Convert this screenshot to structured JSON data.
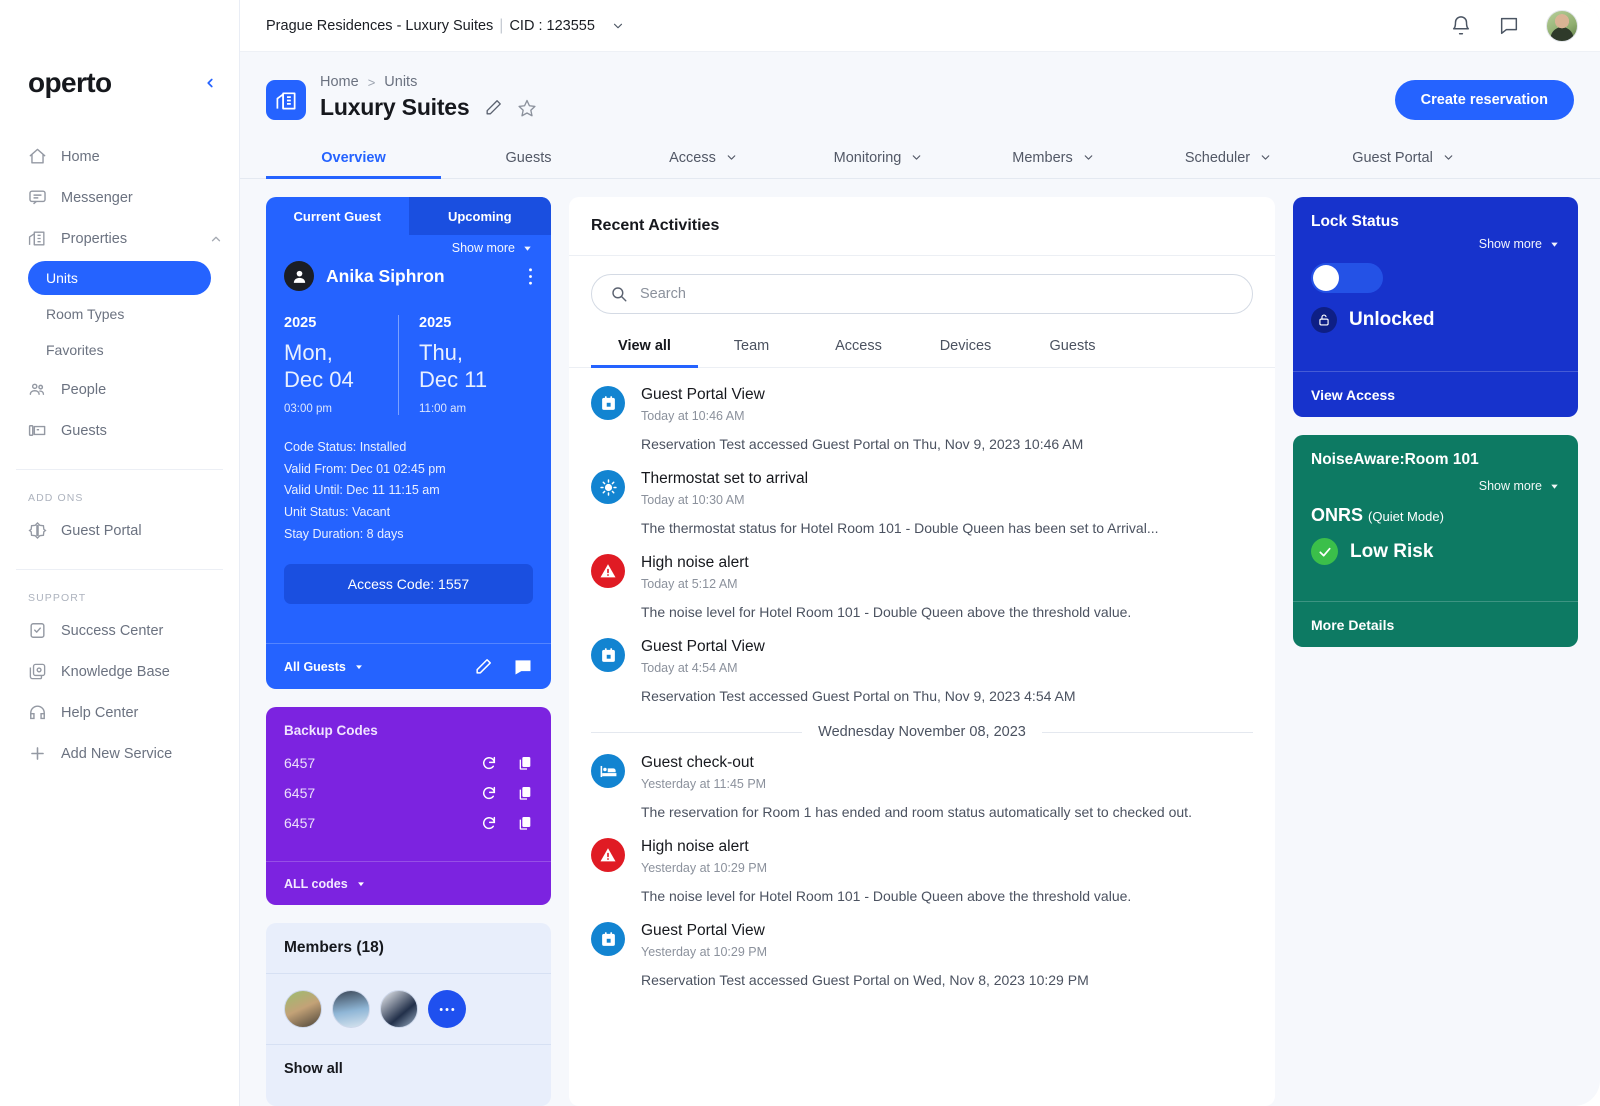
{
  "sidebar": {
    "brand": "operto",
    "collapse_icon": "chevron-left-icon",
    "nav": [
      {
        "label": "Home",
        "icon": "home-icon"
      },
      {
        "label": "Messenger",
        "icon": "messenger-icon"
      },
      {
        "label": "Properties",
        "icon": "properties-icon",
        "caret": "chevron-up-icon"
      }
    ],
    "properties_sub": [
      {
        "label": "Units",
        "active": true
      },
      {
        "label": "Room Types",
        "active": false
      },
      {
        "label": "Favorites",
        "active": false
      }
    ],
    "nav2": [
      {
        "label": "People",
        "icon": "people-icon"
      },
      {
        "label": "Guests",
        "icon": "guests-icon"
      }
    ],
    "addons_title": "ADD ONS",
    "addons": [
      {
        "label": "Guest Portal",
        "icon": "guest-portal-icon"
      }
    ],
    "support_title": "SUPPORT",
    "support": [
      {
        "label": "Success Center",
        "icon": "clipboard-check-icon"
      },
      {
        "label": "Knowledge Base",
        "icon": "book-icon"
      },
      {
        "label": "Help Center",
        "icon": "help-icon"
      },
      {
        "label": "Add New Service",
        "icon": "plus-icon"
      }
    ]
  },
  "topbar": {
    "property": "Prague Residences - Luxury Suites",
    "cid": "CID : 123555",
    "caret": "chevron-down-icon",
    "bell": "bell-icon",
    "chat": "chat-icon",
    "avatar": "user-avatar"
  },
  "page": {
    "breadcrumb": [
      "Home",
      "Units"
    ],
    "separator": ">",
    "title": "Luxury Suites",
    "edit_icon": "pencil-icon",
    "star_icon": "star-icon",
    "create_button": "Create reservation"
  },
  "tabs": [
    {
      "label": "Overview",
      "caret": false,
      "active": true
    },
    {
      "label": "Guests",
      "caret": false,
      "active": false
    },
    {
      "label": "Access",
      "caret": true,
      "active": false
    },
    {
      "label": "Monitoring",
      "caret": true,
      "active": false
    },
    {
      "label": "Members",
      "caret": true,
      "active": false
    },
    {
      "label": "Scheduler",
      "caret": true,
      "active": false
    },
    {
      "label": "Guest Portal",
      "caret": true,
      "active": false
    }
  ],
  "guest_card": {
    "tab_current": "Current Guest",
    "tab_upcoming": "Upcoming",
    "show_more": "Show more",
    "guest_name": "Anika Siphron",
    "checkin": {
      "year": "2025",
      "day": "Mon,",
      "date": "Dec 04",
      "time": "03:00 pm"
    },
    "checkout": {
      "year": "2025",
      "day": "Thu,",
      "date": "Dec 11",
      "time": "11:00 am"
    },
    "meta": [
      "Code Status: Installed",
      "Valid From: Dec 01 02:45 pm",
      "Valid Until: Dec 11 11:15 am",
      "Unit Status: Vacant",
      "Stay Duration: 8 days"
    ],
    "access_code": "Access Code: 1557",
    "all_guests": "All Guests",
    "edit_icon": "pencil-icon",
    "message_icon": "message-icon"
  },
  "backup_codes": {
    "title": "Backup Codes",
    "codes": [
      "6457",
      "6457",
      "6457"
    ],
    "refresh_icon": "refresh-icon",
    "copy_icon": "copy-icon",
    "footer": "ALL codes"
  },
  "members": {
    "title": "Members (18)",
    "more_label": "•••",
    "show_all": "Show all"
  },
  "activities": {
    "title": "Recent Activities",
    "search_placeholder": "Search",
    "search_value": "",
    "search_icon": "search-icon",
    "tabs": [
      {
        "label": "View all",
        "active": true
      },
      {
        "label": "Team",
        "active": false
      },
      {
        "label": "Access",
        "active": false
      },
      {
        "label": "Devices",
        "active": false
      },
      {
        "label": "Guests",
        "active": false
      }
    ],
    "items": [
      {
        "icon": "calendar-icon",
        "color": "blue",
        "title": "Guest Portal View",
        "time": "Today at 10:46 AM",
        "desc": "Reservation Test accessed Guest Portal on Thu, Nov 9, 2023 10:46 AM"
      },
      {
        "icon": "thermostat-icon",
        "color": "blue",
        "title": "Thermostat set to arrival",
        "time": "Today at 10:30 AM",
        "desc": "The thermostat status for Hotel Room 101 - Double Queen has been set to Arrival..."
      },
      {
        "icon": "alert-icon",
        "color": "red",
        "title": "High noise alert",
        "time": "Today at 5:12 AM",
        "desc": "The noise level for Hotel Room 101 - Double Queen above the threshold value."
      },
      {
        "icon": "calendar-icon",
        "color": "blue",
        "title": "Guest Portal View",
        "time": "Today at 4:54 AM",
        "desc": "Reservation Test accessed Guest Portal on Thu, Nov 9, 2023 4:54 AM"
      }
    ],
    "day_separator": "Wednesday November 08, 2023",
    "items2": [
      {
        "icon": "bed-icon",
        "color": "blue",
        "title": "Guest check-out",
        "time": "Yesterday at 11:45 PM",
        "desc": "The reservation for Room 1 has ended and room status automatically set to checked out."
      },
      {
        "icon": "alert-icon",
        "color": "red",
        "title": "High noise alert",
        "time": "Yesterday at 10:29 PM",
        "desc": "The noise level for Hotel Room 101 - Double Queen above the threshold value."
      },
      {
        "icon": "calendar-icon",
        "color": "blue",
        "title": "Guest Portal View",
        "time": "Yesterday at 10:29 PM",
        "desc": "Reservation Test accessed Guest Portal on Wed, Nov 8, 2023 10:29 PM"
      }
    ]
  },
  "lock_status": {
    "title": "Lock Status",
    "show_more": "Show more",
    "status": "Unlocked",
    "lock_icon": "unlock-icon",
    "footer": "View Access"
  },
  "noise": {
    "title": "NoiseAware:Room 101",
    "show_more": "Show more",
    "mode": "ONRS",
    "mode_note": "(Quiet Mode)",
    "risk": "Low Risk",
    "check_icon": "check-circle-icon",
    "footer": "More Details"
  },
  "colors": {
    "brand_blue": "#2563ff",
    "deep_blue": "#1733cc",
    "purple": "#7c23e0",
    "teal": "#0d7a63",
    "red": "#e01b24",
    "icon_blue": "#1284d1",
    "green": "#3bbf4a"
  }
}
